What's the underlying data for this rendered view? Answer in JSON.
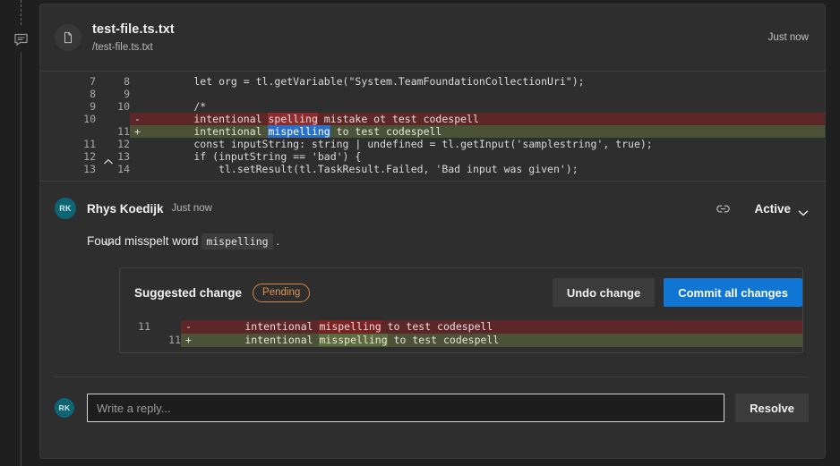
{
  "rail": {
    "thread_icon": "comment-bubble-icon"
  },
  "file_header": {
    "icon": "file-icon",
    "name": "test-file.ts.txt",
    "path": "/test-file.ts.txt",
    "time": "Just now"
  },
  "code_diff": {
    "expand_up_icon": "chevron-up-icon",
    "expand_down_icon": "chevron-down-icon",
    "rows": [
      {
        "type": "ctx",
        "old": "7",
        "new": "8",
        "sign": "",
        "code": "        let org = tl.getVariable(\"System.TeamFoundationCollectionUri\");"
      },
      {
        "type": "ctx",
        "old": "8",
        "new": "9",
        "sign": "",
        "code": ""
      },
      {
        "type": "ctx",
        "old": "9",
        "new": "10",
        "sign": "",
        "code": "        /*"
      },
      {
        "type": "del",
        "old": "10",
        "new": "",
        "sign": "-",
        "code_pre": "        intentional ",
        "code_hl": "spelling",
        "code_post": " mistake ot test codespell"
      },
      {
        "type": "add",
        "old": "",
        "new": "11",
        "sign": "+",
        "code_pre": "        intentional ",
        "code_hl": "mispelling",
        "code_post": " to test codespell"
      },
      {
        "type": "ctx",
        "old": "11",
        "new": "12",
        "sign": "",
        "code": "        const inputString: string | undefined = tl.getInput('samplestring', true);"
      },
      {
        "type": "ctx",
        "old": "12",
        "new": "13",
        "sign": "",
        "code": "        if (inputString == 'bad') {"
      },
      {
        "type": "ctx",
        "old": "13",
        "new": "14",
        "sign": "",
        "code": "            tl.setResult(tl.TaskResult.Failed, 'Bad input was given');"
      }
    ]
  },
  "comment": {
    "avatar_initials": "RK",
    "author": "Rhys Koedijk",
    "time": "Just now",
    "link_icon": "link-icon",
    "status_label": "Active",
    "status_caret_icon": "chevron-down-icon",
    "body_before": "Found misspelt word",
    "body_code": "mispelling",
    "body_after": "."
  },
  "suggestion": {
    "title": "Suggested change",
    "badge": "Pending",
    "badge_color": "#e09450",
    "undo_label": "Undo change",
    "commit_label": "Commit all changes",
    "commit_color": "#0f76d4",
    "rows": [
      {
        "type": "del",
        "old": "11",
        "new": "",
        "sign": "-",
        "code_pre": "        intentional ",
        "code_hl": "mispelling",
        "code_post": " to test codespell"
      },
      {
        "type": "add",
        "old": "",
        "new": "11",
        "sign": "+",
        "code_pre": "        intentional ",
        "code_hl": "misspelling",
        "code_post": " to test codespell"
      }
    ]
  },
  "reply": {
    "avatar_initials": "RK",
    "placeholder": "Write a reply...",
    "value": "",
    "resolve_label": "Resolve"
  }
}
